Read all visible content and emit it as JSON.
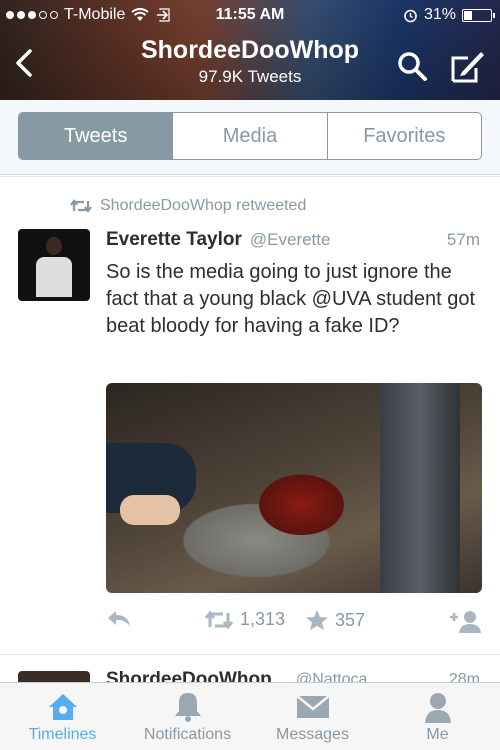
{
  "status_bar": {
    "carrier": "T-Mobile",
    "time": "11:55 AM",
    "battery": "31%",
    "battery_level": 0.31
  },
  "header": {
    "title": "ShordeeDooWhop",
    "subtitle": "97.9K Tweets"
  },
  "segments": {
    "items": [
      {
        "label": "Tweets",
        "active": true
      },
      {
        "label": "Media",
        "active": false
      },
      {
        "label": "Favorites",
        "active": false
      }
    ]
  },
  "tweet": {
    "retweeted_by": "ShordeeDooWhop retweeted",
    "author_name": "Everette Taylor",
    "author_handle": "@Everette",
    "time": "57m",
    "text": "So is the media going to just ignore the fact that a young black @UVA student got beat bloody for having a fake ID?",
    "retweet_count": "1,313",
    "favorite_count": "357"
  },
  "next_tweet": {
    "author_name": "ShordeeDooWhop",
    "author_handle": "@Nattoca",
    "time": "28m"
  },
  "tabbar": {
    "items": [
      {
        "label": "Timelines",
        "active": true
      },
      {
        "label": "Notifications",
        "active": false
      },
      {
        "label": "Messages",
        "active": false
      },
      {
        "label": "Me",
        "active": false
      }
    ]
  },
  "colors": {
    "accent": "#55acee",
    "muted": "#8899a6"
  }
}
